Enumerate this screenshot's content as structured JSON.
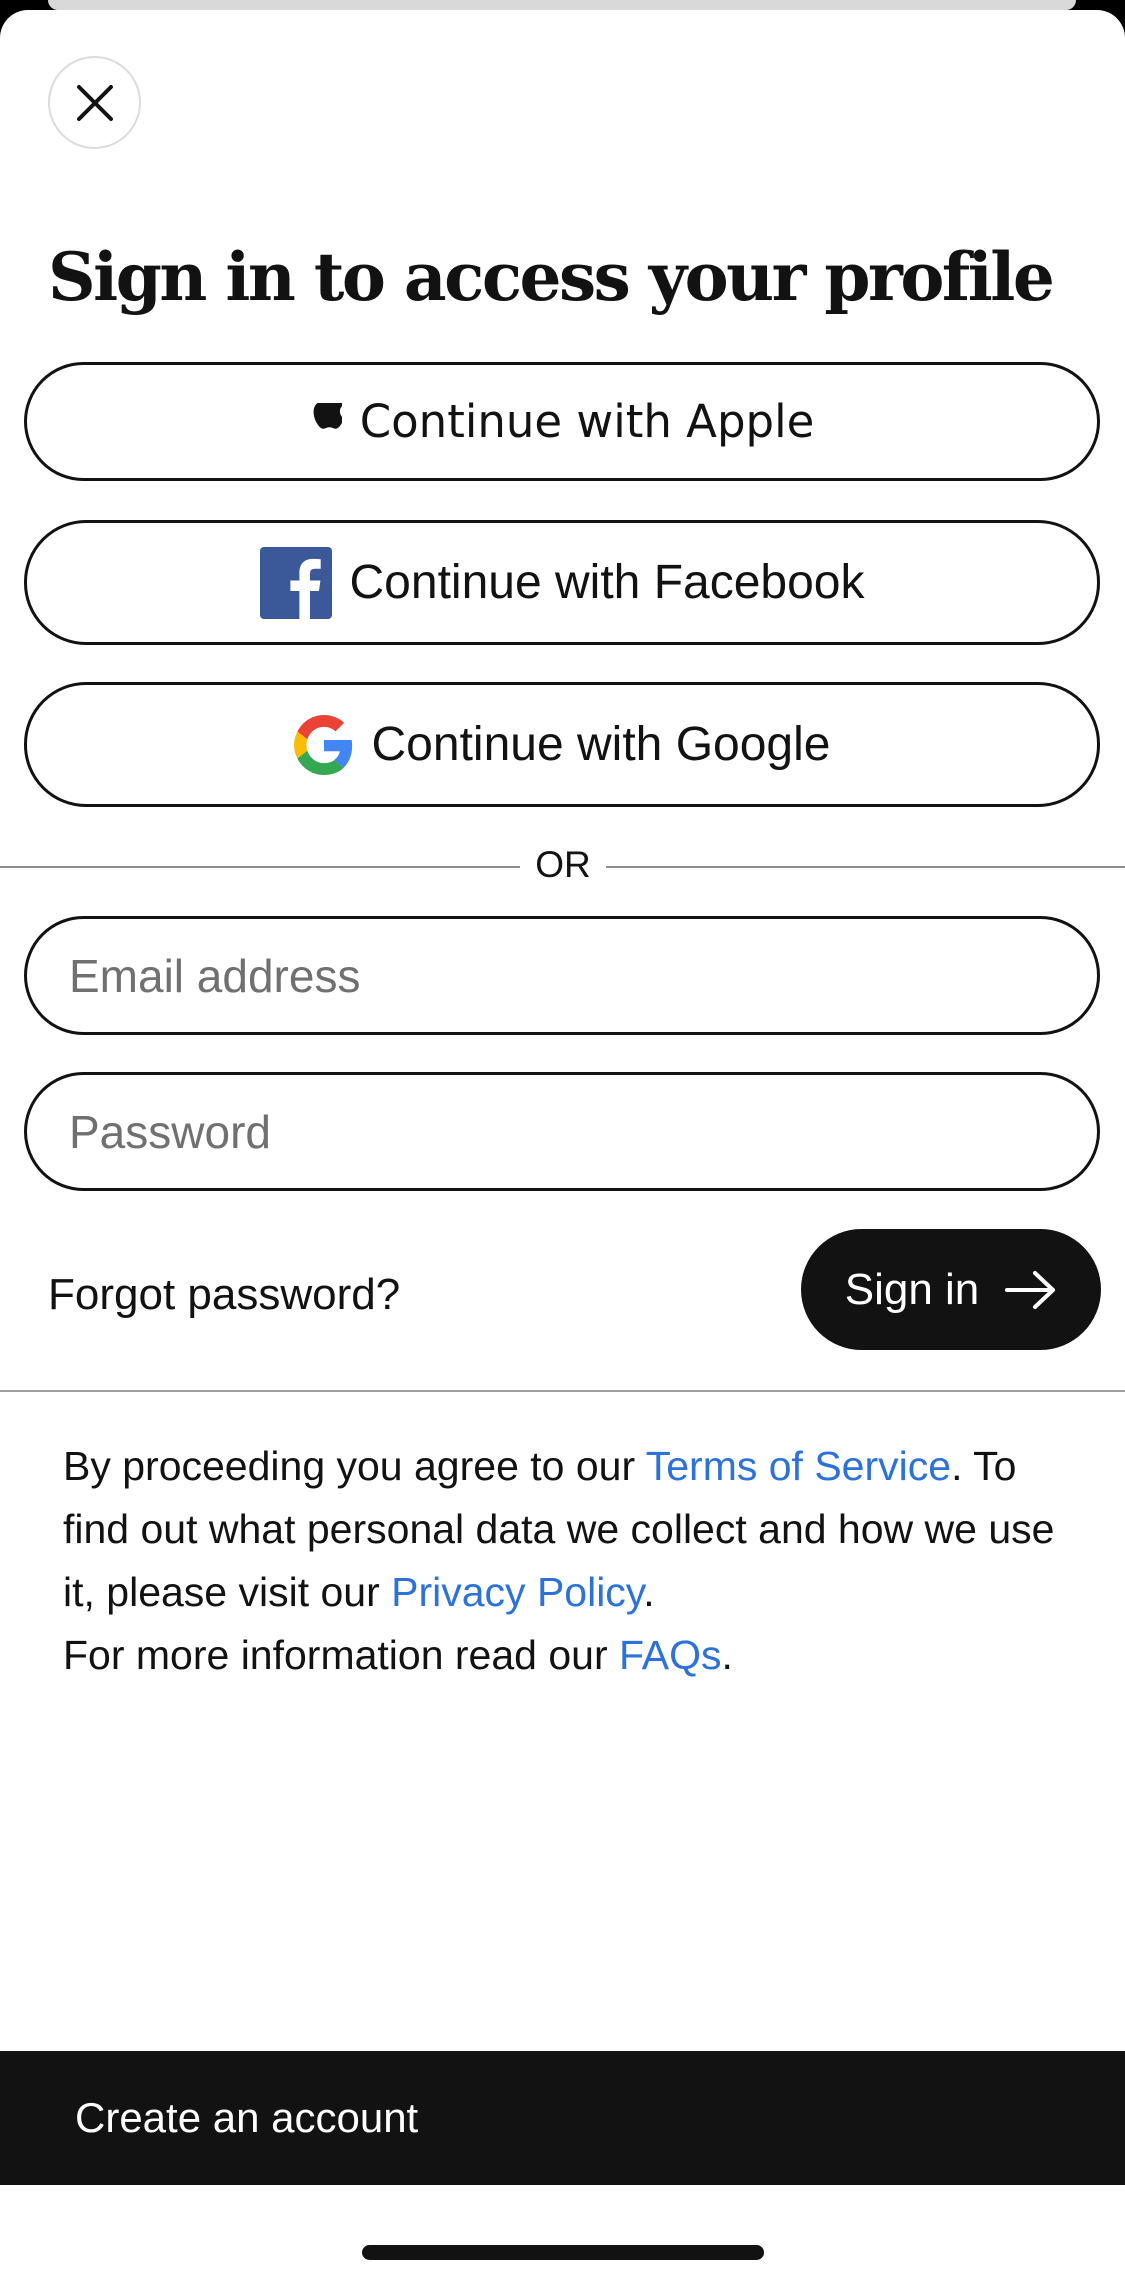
{
  "header": {
    "close_label": "Close",
    "title": "Sign in to access your profile"
  },
  "social": {
    "apple_label": "Continue with Apple",
    "facebook_label": "Continue with Facebook",
    "google_label": "Continue with Google"
  },
  "divider": {
    "or_label": "OR"
  },
  "form": {
    "email_placeholder": "Email address",
    "password_placeholder": "Password",
    "forgot_label": "Forgot password?",
    "signin_label": "Sign in"
  },
  "legal": {
    "part1": "By proceeding you agree to our ",
    "terms_link": "Terms of Service",
    "part2": ". To find out what personal data we collect and how we use it, please visit our ",
    "privacy_link": "Privacy Policy",
    "part3": ".",
    "part4": "For more information read our ",
    "faqs_link": "FAQs",
    "part5": "."
  },
  "footer": {
    "create_label": "Create an account"
  },
  "colors": {
    "text": "#121212",
    "link": "#2d72d9",
    "facebook": "#3b5998",
    "google_blue": "#4285F4",
    "google_red": "#EA4335",
    "google_yellow": "#FBBC05",
    "google_green": "#34A853"
  },
  "icons": {
    "close": "close-icon",
    "apple": "apple-logo-icon",
    "facebook": "facebook-logo-icon",
    "google": "google-logo-icon",
    "arrow": "arrow-right-icon"
  }
}
